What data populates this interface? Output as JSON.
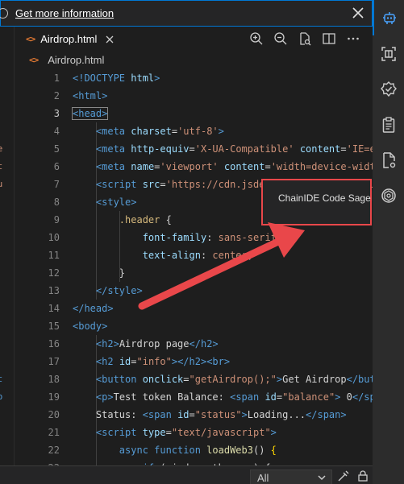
{
  "info_bar": {
    "link_text": "Get more information"
  },
  "tabs": [
    {
      "label": "Airdrop.html"
    }
  ],
  "breadcrumb": {
    "file": "Airdrop.html"
  },
  "tooltip": {
    "label": "ChainIDE Code Sage"
  },
  "bottom_panel": {
    "filter_value": "All"
  },
  "left_fragments": [
    "=e",
    "dt",
    "eu",
    "ut",
    "sp"
  ],
  "code_lines": [
    {
      "n": "1",
      "parts": [
        [
          "t-tag",
          "<!DOCTYPE "
        ],
        [
          "t-attr",
          "html"
        ],
        [
          "t-tag",
          ">"
        ]
      ]
    },
    {
      "n": "2",
      "parts": [
        [
          "t-tag",
          "<html>"
        ]
      ]
    },
    {
      "n": "3",
      "parts": [
        [
          "t-tag",
          "<head>"
        ]
      ]
    },
    {
      "n": "4",
      "parts": [
        [
          "t-txt",
          "    "
        ],
        [
          "t-tag",
          "<meta "
        ],
        [
          "t-attr",
          "charset"
        ],
        [
          "t-txt",
          "="
        ],
        [
          "t-str",
          "'utf-8'"
        ],
        [
          "t-tag",
          ">"
        ]
      ]
    },
    {
      "n": "5",
      "parts": [
        [
          "t-txt",
          "    "
        ],
        [
          "t-tag",
          "<meta "
        ],
        [
          "t-attr",
          "http-equiv"
        ],
        [
          "t-txt",
          "="
        ],
        [
          "t-str",
          "'X-UA-Compatible'"
        ],
        [
          "t-txt",
          " "
        ],
        [
          "t-attr",
          "content"
        ],
        [
          "t-txt",
          "="
        ],
        [
          "t-str",
          "'IE=e"
        ]
      ]
    },
    {
      "n": "6",
      "parts": [
        [
          "t-txt",
          "    "
        ],
        [
          "t-tag",
          "<meta "
        ],
        [
          "t-attr",
          "name"
        ],
        [
          "t-txt",
          "="
        ],
        [
          "t-str",
          "'viewport'"
        ],
        [
          "t-txt",
          " "
        ],
        [
          "t-attr",
          "content"
        ],
        [
          "t-txt",
          "="
        ],
        [
          "t-str",
          "'width=device-widt"
        ]
      ]
    },
    {
      "n": "7",
      "parts": [
        [
          "t-txt",
          "    "
        ],
        [
          "t-tag",
          "<script "
        ],
        [
          "t-attr",
          "src"
        ],
        [
          "t-txt",
          "="
        ],
        [
          "t-str",
          "'https://cdn.jsdelivr.net/gh/ethereu"
        ]
      ]
    },
    {
      "n": "8",
      "parts": [
        [
          "t-txt",
          "    "
        ],
        [
          "t-tag",
          "<style>"
        ]
      ]
    },
    {
      "n": "9",
      "parts": [
        [
          "t-txt",
          "        "
        ],
        [
          "t-sel",
          ".header"
        ],
        [
          "t-txt",
          " {"
        ]
      ]
    },
    {
      "n": "10",
      "parts": [
        [
          "t-txt",
          "            "
        ],
        [
          "t-prop",
          "font-family"
        ],
        [
          "t-txt",
          ": "
        ],
        [
          "t-val",
          "sans-serif"
        ],
        [
          "t-txt",
          ";"
        ]
      ]
    },
    {
      "n": "11",
      "parts": [
        [
          "t-txt",
          "            "
        ],
        [
          "t-prop",
          "text-align"
        ],
        [
          "t-txt",
          ": "
        ],
        [
          "t-val",
          "center"
        ],
        [
          "t-txt",
          ";"
        ]
      ]
    },
    {
      "n": "12",
      "parts": [
        [
          "t-txt",
          "        }"
        ]
      ]
    },
    {
      "n": "13",
      "parts": [
        [
          "t-txt",
          "    "
        ],
        [
          "t-tag",
          "</style>"
        ]
      ]
    },
    {
      "n": "14",
      "parts": [
        [
          "t-tag",
          "</head>"
        ]
      ]
    },
    {
      "n": "15",
      "parts": [
        [
          "t-tag",
          "<body>"
        ]
      ]
    },
    {
      "n": "16",
      "parts": [
        [
          "t-txt",
          "    "
        ],
        [
          "t-tag",
          "<h2>"
        ],
        [
          "t-txt",
          "Airdrop page"
        ],
        [
          "t-tag",
          "</h2>"
        ]
      ]
    },
    {
      "n": "17",
      "parts": [
        [
          "t-txt",
          "    "
        ],
        [
          "t-tag",
          "<h2 "
        ],
        [
          "t-attr",
          "id"
        ],
        [
          "t-txt",
          "="
        ],
        [
          "t-str",
          "\"info\""
        ],
        [
          "t-tag",
          "></h2><br>"
        ]
      ]
    },
    {
      "n": "18",
      "parts": [
        [
          "t-txt",
          "    "
        ],
        [
          "t-tag",
          "<button "
        ],
        [
          "t-attr",
          "onclick"
        ],
        [
          "t-txt",
          "="
        ],
        [
          "t-str",
          "\"getAirdrop();\""
        ],
        [
          "t-tag",
          ">"
        ],
        [
          "t-txt",
          "Get Airdrop"
        ],
        [
          "t-tag",
          "</but"
        ]
      ]
    },
    {
      "n": "19",
      "parts": [
        [
          "t-txt",
          "    "
        ],
        [
          "t-tag",
          "<p>"
        ],
        [
          "t-txt",
          "Test token Balance: "
        ],
        [
          "t-tag",
          "<span "
        ],
        [
          "t-attr",
          "id"
        ],
        [
          "t-txt",
          "="
        ],
        [
          "t-str",
          "\"balance\""
        ],
        [
          "t-tag",
          ">"
        ],
        [
          "t-txt",
          " 0"
        ],
        [
          "t-tag",
          "</sp"
        ]
      ]
    },
    {
      "n": "20",
      "parts": [
        [
          "t-txt",
          "    Status: "
        ],
        [
          "t-tag",
          "<span "
        ],
        [
          "t-attr",
          "id"
        ],
        [
          "t-txt",
          "="
        ],
        [
          "t-str",
          "\"status\""
        ],
        [
          "t-tag",
          ">"
        ],
        [
          "t-txt",
          "Loading..."
        ],
        [
          "t-tag",
          "</span>"
        ]
      ]
    },
    {
      "n": "21",
      "parts": [
        [
          "t-txt",
          "    "
        ],
        [
          "t-tag",
          "<script "
        ],
        [
          "t-attr",
          "type"
        ],
        [
          "t-txt",
          "="
        ],
        [
          "t-str",
          "\"text/javascript\""
        ],
        [
          "t-tag",
          ">"
        ]
      ]
    },
    {
      "n": "22",
      "parts": [
        [
          "t-txt",
          "        "
        ],
        [
          "t-kw",
          "async function "
        ],
        [
          "t-fn",
          "loadWeb3"
        ],
        [
          "t-txt",
          "() "
        ],
        [
          "t-br",
          "{"
        ]
      ]
    },
    {
      "n": "23",
      "parts": [
        [
          "t-txt",
          "            "
        ],
        [
          "t-kw",
          "if"
        ],
        [
          "t-txt",
          " (window.ethereum) {"
        ]
      ]
    }
  ],
  "colors": {
    "accent": "#0078d4",
    "highlight": "#e9474a",
    "activity_bg": "#2c2c2c"
  }
}
